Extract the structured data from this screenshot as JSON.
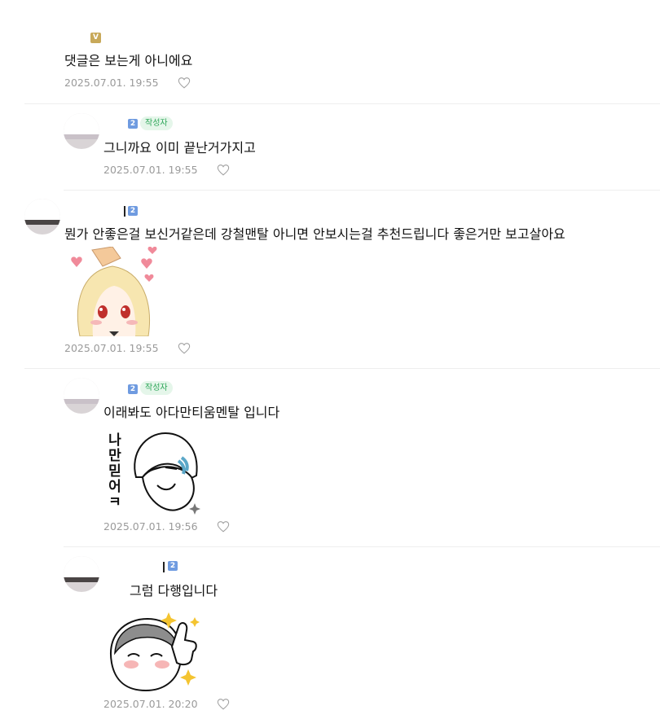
{
  "comments": [
    {
      "badge": "V",
      "text": "댓글은 보는게 아니에요",
      "date": "2025.07.01. 19:55"
    },
    {
      "level": "2",
      "author_tag": "작성자",
      "text": "그니까요 이미 끝난거가지고",
      "date": "2025.07.01. 19:55"
    },
    {
      "level": "2",
      "text": "뭔가 안좋은걸 보신거같은데 강철맨탈 아니면 안보시는걸 추천드립니다 좋은거만 보고살아요",
      "date": "2025.07.01. 19:55",
      "sticker": "blonde-girl-headpat-sticker"
    },
    {
      "level": "2",
      "author_tag": "작성자",
      "text": "이래봐도 아다만티움멘탈 입니다",
      "date": "2025.07.01. 19:56",
      "sticker": "girl-trust-me-sticker",
      "sticker_text": [
        "나",
        "만",
        "믿",
        "어",
        "ㅋ"
      ]
    },
    {
      "level": "2",
      "text": "그럼 다행입니다",
      "date": "2025.07.01. 20:20",
      "sticker": "girl-thumbs-up-sticker"
    }
  ],
  "colors": {
    "author_tag_bg": "#e5f6ea",
    "author_tag_text": "#2fa75a",
    "level_badge": "#6f9be0",
    "v_badge": "#c8a95a",
    "date": "#9a9a9a"
  },
  "icons": {
    "like": "heart-outline-icon"
  }
}
